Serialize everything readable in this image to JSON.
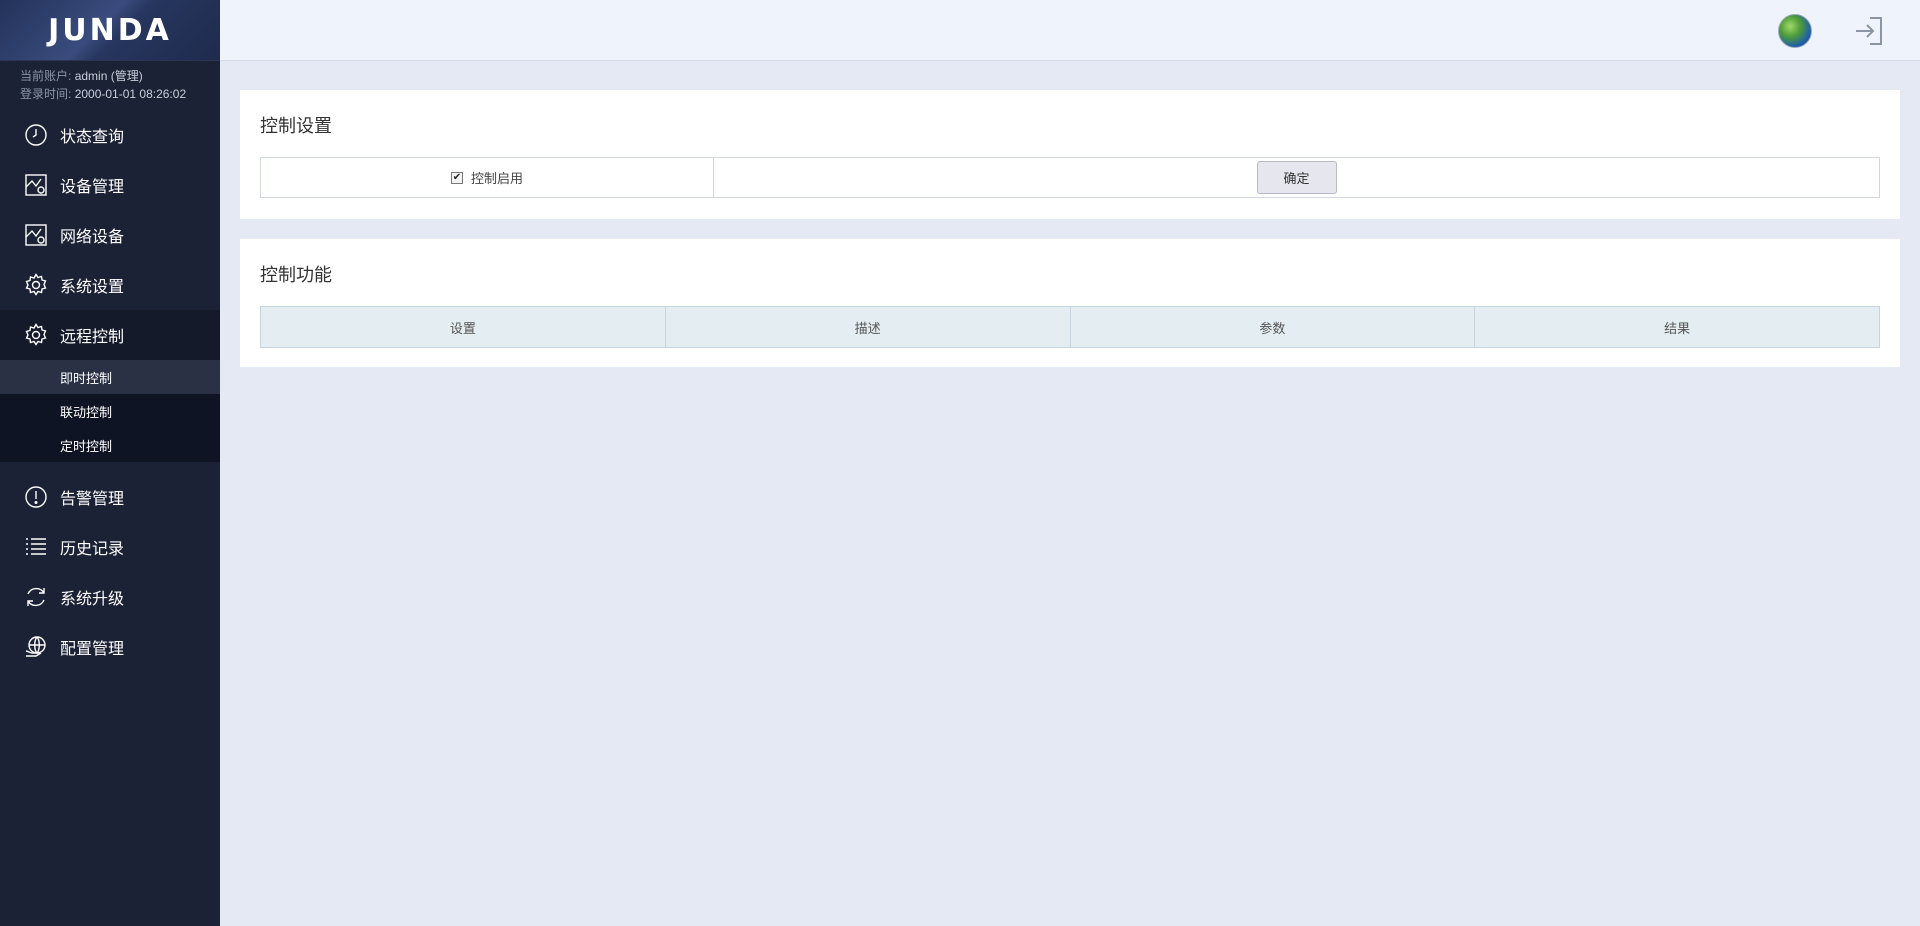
{
  "brand": {
    "logo_text": "JUNDA"
  },
  "account": {
    "user_label": "当前账户:",
    "user_value": "admin (管理)",
    "login_label": "登录时间:",
    "login_value": "2000-01-01 08:26:02"
  },
  "nav": {
    "items": [
      {
        "label": "状态查询",
        "icon": "clock-icon"
      },
      {
        "label": "设备管理",
        "icon": "device-icon"
      },
      {
        "label": "网络设备",
        "icon": "network-device-icon"
      },
      {
        "label": "系统设置",
        "icon": "gear-icon"
      },
      {
        "label": "远程控制",
        "icon": "gear-icon"
      },
      {
        "label": "告警管理",
        "icon": "alert-icon"
      },
      {
        "label": "历史记录",
        "icon": "list-icon"
      },
      {
        "label": "系统升级",
        "icon": "refresh-icon"
      },
      {
        "label": "配置管理",
        "icon": "globe-hand-icon"
      }
    ],
    "remote_control_sub": [
      {
        "label": "即时控制"
      },
      {
        "label": "联动控制"
      },
      {
        "label": "定时控制"
      }
    ]
  },
  "control_settings": {
    "title": "控制设置",
    "enable_label": "控制启用",
    "enable_checked": true,
    "confirm_label": "确定"
  },
  "control_functions": {
    "title": "控制功能",
    "columns": [
      "设置",
      "描述",
      "参数",
      "结果"
    ]
  },
  "colors": {
    "sidebar_bg": "#1b2235",
    "submenu_bg": "#0f1424",
    "content_bg": "#e4e9f3",
    "table_header_bg": "#e3edf2"
  }
}
